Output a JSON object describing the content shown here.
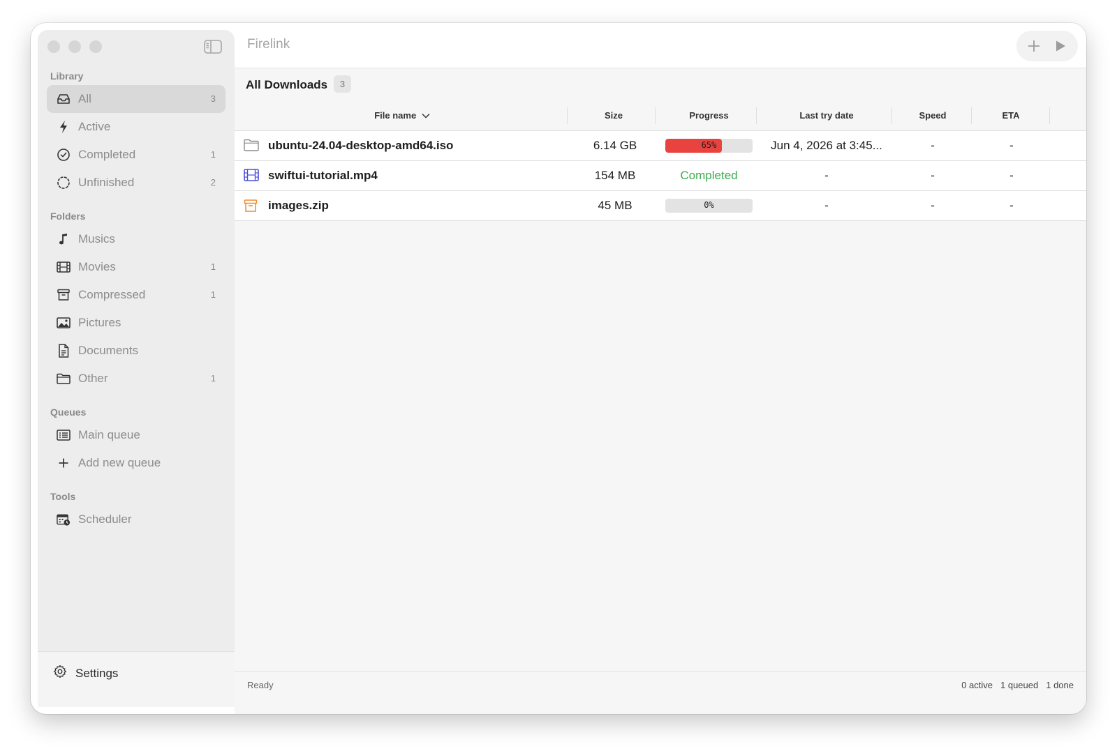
{
  "app": {
    "title": "Firelink"
  },
  "sidebar": {
    "sections": {
      "library": "Library",
      "folders": "Folders",
      "queues": "Queues",
      "tools": "Tools"
    },
    "library": [
      {
        "label": "All",
        "count": "3",
        "icon": "tray-icon",
        "selected": true
      },
      {
        "label": "Active",
        "count": "",
        "icon": "bolt-icon"
      },
      {
        "label": "Completed",
        "count": "1",
        "icon": "checkmark-circle-icon"
      },
      {
        "label": "Unfinished",
        "count": "2",
        "icon": "dashed-circle-icon"
      }
    ],
    "folders": [
      {
        "label": "Musics",
        "count": "",
        "icon": "music-note-icon"
      },
      {
        "label": "Movies",
        "count": "1",
        "icon": "film-icon"
      },
      {
        "label": "Compressed",
        "count": "1",
        "icon": "archive-box-icon"
      },
      {
        "label": "Pictures",
        "count": "",
        "icon": "photo-icon"
      },
      {
        "label": "Documents",
        "count": "",
        "icon": "document-icon"
      },
      {
        "label": "Other",
        "count": "1",
        "icon": "folder-icon"
      }
    ],
    "queues": [
      {
        "label": "Main queue",
        "icon": "list-icon"
      },
      {
        "label": "Add new queue",
        "icon": "plus-icon"
      }
    ],
    "tools": [
      {
        "label": "Scheduler",
        "icon": "calendar-clock-icon"
      }
    ],
    "settings_label": "Settings"
  },
  "list": {
    "title": "All Downloads",
    "count": "3",
    "columns": {
      "name": "File name",
      "size": "Size",
      "progress": "Progress",
      "last_try": "Last try date",
      "speed": "Speed",
      "eta": "ETA"
    },
    "rows": [
      {
        "name": "ubuntu-24.04-desktop-amd64.iso",
        "icon": "folder-icon",
        "size": "6.14 GB",
        "progress_text": "65%",
        "progress": 0.65,
        "last_try": "Jun 4, 2026 at 3:45...",
        "speed": "-",
        "eta": "-"
      },
      {
        "name": "swiftui-tutorial.mp4",
        "icon": "film-icon",
        "size": "154 MB",
        "status": "Completed",
        "last_try": "-",
        "speed": "-",
        "eta": "-"
      },
      {
        "name": "images.zip",
        "icon": "archive-box-icon",
        "size": "45 MB",
        "progress_text": "0%",
        "progress": 0,
        "last_try": "-",
        "speed": "-",
        "eta": "-"
      }
    ]
  },
  "statusbar": {
    "left": "Ready",
    "active": "0 active",
    "queued": "1 queued",
    "done": "1 done"
  },
  "colors": {
    "accent_red": "#e8433f",
    "completed_green": "#3cab4d",
    "movie_icon": "#4a4fd8",
    "archive_icon": "#f08a2c"
  }
}
